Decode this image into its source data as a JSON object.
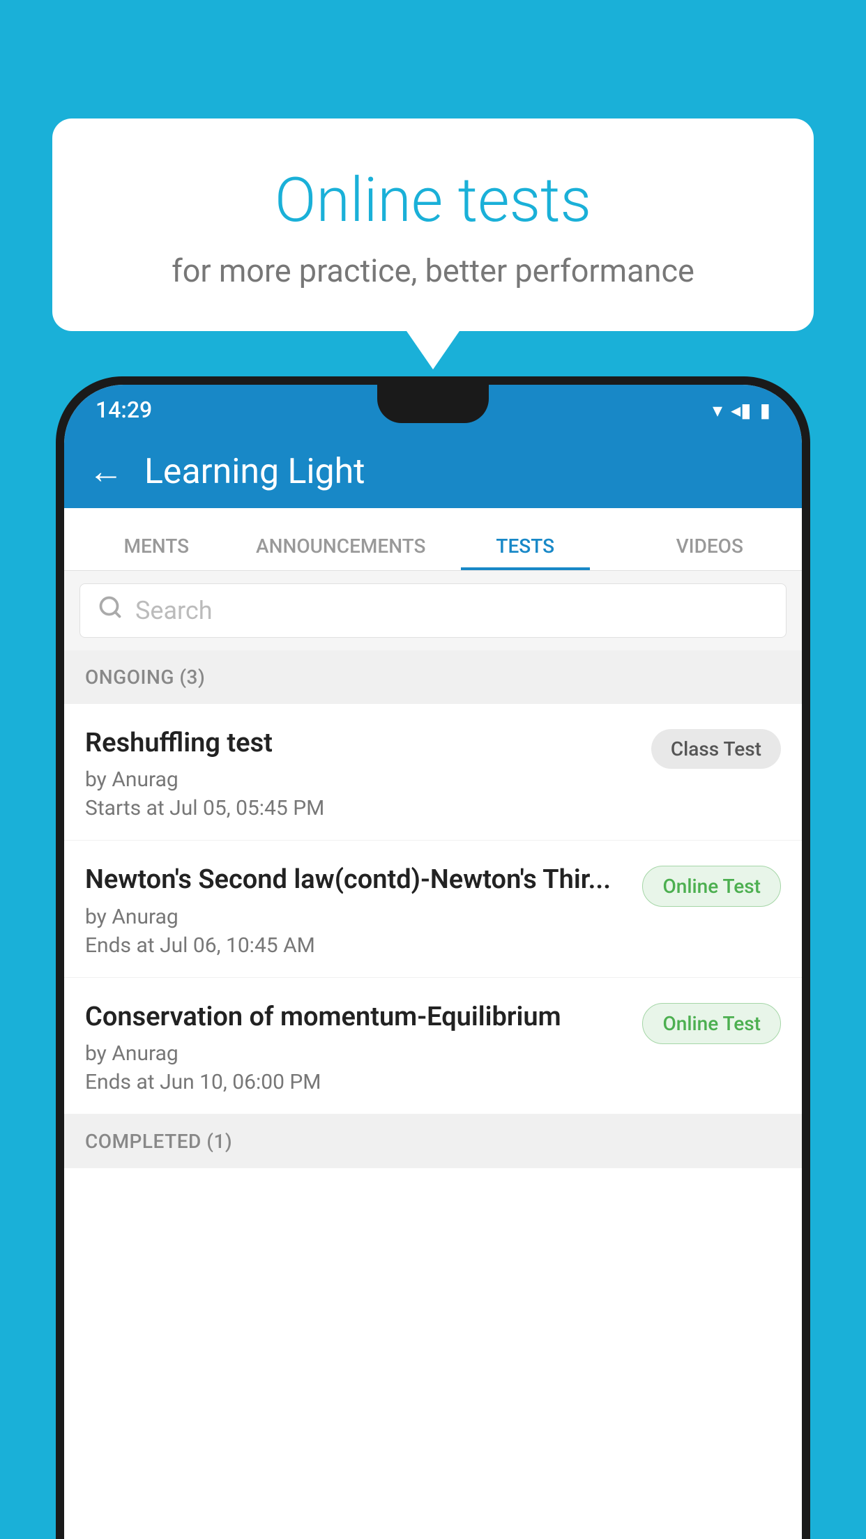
{
  "background": {
    "color": "#1ab0d8"
  },
  "speech_bubble": {
    "title": "Online tests",
    "subtitle": "for more practice, better performance"
  },
  "status_bar": {
    "time": "14:29",
    "wifi_icon": "▾",
    "signal_icon": "◂",
    "battery_icon": "▮"
  },
  "app_header": {
    "back_label": "←",
    "title": "Learning Light"
  },
  "tabs": [
    {
      "label": "MENTS",
      "active": false
    },
    {
      "label": "ANNOUNCEMENTS",
      "active": false
    },
    {
      "label": "TESTS",
      "active": true
    },
    {
      "label": "VIDEOS",
      "active": false
    }
  ],
  "search": {
    "placeholder": "Search"
  },
  "ongoing_section": {
    "label": "ONGOING (3)"
  },
  "tests": [
    {
      "name": "Reshuffling test",
      "author": "by Anurag",
      "time_label": "Starts at",
      "time": "Jul 05, 05:45 PM",
      "badge": "Class Test",
      "badge_type": "class"
    },
    {
      "name": "Newton's Second law(contd)-Newton's Thir...",
      "author": "by Anurag",
      "time_label": "Ends at",
      "time": "Jul 06, 10:45 AM",
      "badge": "Online Test",
      "badge_type": "online"
    },
    {
      "name": "Conservation of momentum-Equilibrium",
      "author": "by Anurag",
      "time_label": "Ends at",
      "time": "Jun 10, 06:00 PM",
      "badge": "Online Test",
      "badge_type": "online"
    }
  ],
  "completed_section": {
    "label": "COMPLETED (1)"
  }
}
